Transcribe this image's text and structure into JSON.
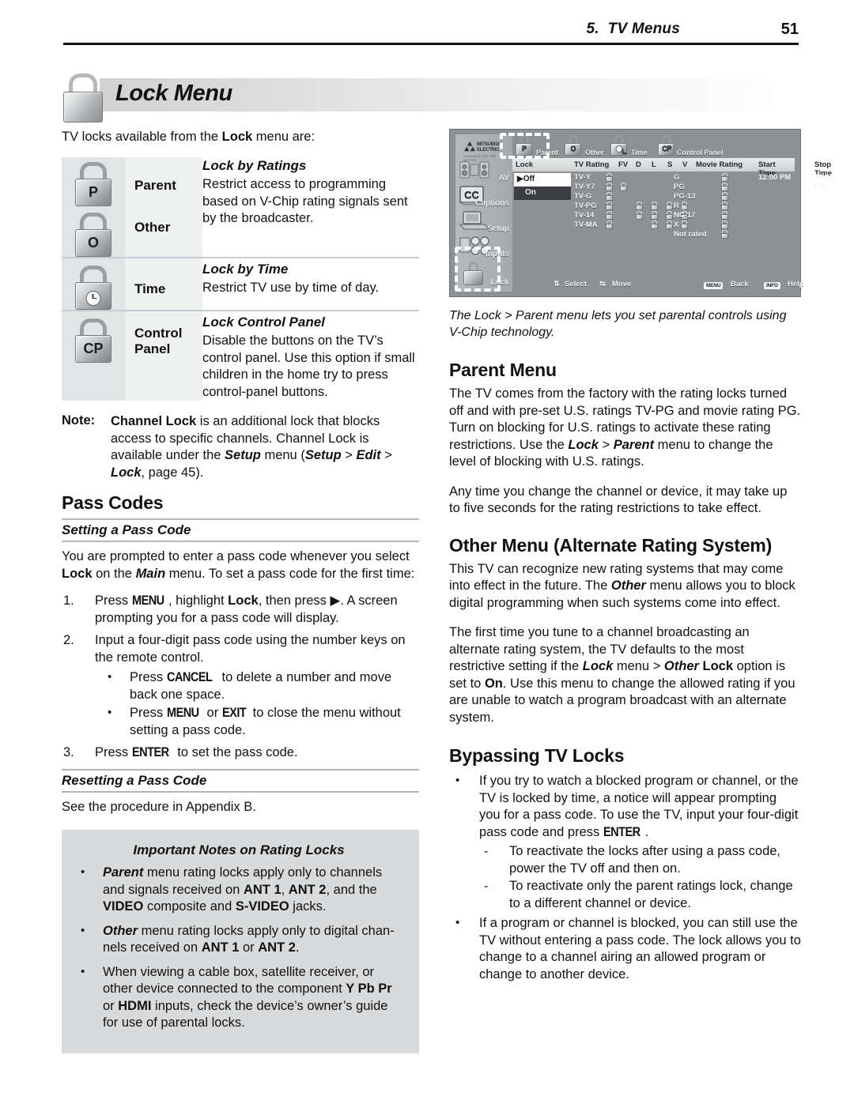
{
  "header": {
    "chapter": "5.",
    "title": "TV Menus",
    "page_number": "51"
  },
  "banner": {
    "title": "Lock Menu",
    "icon": "padlock-icon"
  },
  "intro": {
    "before": "TV locks available from the ",
    "bold": "Lock",
    "after": " menu are:"
  },
  "locks_table": {
    "rows": [
      {
        "icons": [
          {
            "label": "P",
            "name": "parent-lock-icon"
          },
          {
            "label": "O",
            "name": "other-lock-icon"
          }
        ],
        "names": [
          "Parent",
          "Other"
        ],
        "heading": "Lock by Ratings",
        "body": "Restrict access to programming based on V-Chip rating signals sent by the broadcaster."
      },
      {
        "icons": [
          {
            "label": "clock",
            "name": "time-lock-icon"
          }
        ],
        "names": [
          "Time"
        ],
        "heading": "Lock by Time",
        "body": "Restrict TV use by time of day."
      },
      {
        "icons": [
          {
            "label": "CP",
            "name": "control-panel-lock-icon"
          }
        ],
        "names": [
          "Control",
          "Panel"
        ],
        "heading": "Lock Control Panel",
        "body": "Disable the buttons on the TV’s control panel.  Use this option if small children in the home try to press control-panel buttons."
      }
    ]
  },
  "note": {
    "label": "Note:",
    "text_parts": [
      {
        "t": "Channel Lock",
        "s": "b"
      },
      {
        "t": " is an additional lock that blocks access to specific channels.  Channel Lock is available under the ",
        "s": "n"
      },
      {
        "t": "Setup",
        "s": "bi"
      },
      {
        "t": " menu (",
        "s": "n"
      },
      {
        "t": "Setup",
        "s": "bi"
      },
      {
        "t": " > ",
        "s": "n"
      },
      {
        "t": "Edit",
        "s": "bi"
      },
      {
        "t": " > ",
        "s": "n"
      },
      {
        "t": "Lock",
        "s": "bi"
      },
      {
        "t": ", page 45).",
        "s": "n"
      }
    ]
  },
  "pass_codes": {
    "heading": "Pass Codes",
    "setting_heading": "Setting a Pass Code",
    "setting_intro_parts": [
      {
        "t": "You are prompted to enter a pass code whenever you select ",
        "s": "n"
      },
      {
        "t": "Lock",
        "s": "b"
      },
      {
        "t": " on the ",
        "s": "n"
      },
      {
        "t": "Main",
        "s": "bi"
      },
      {
        "t": " menu.  To set a pass code for the first time:",
        "s": "n"
      }
    ],
    "steps": [
      {
        "num": "1.",
        "parts": [
          {
            "t": "Press ",
            "s": "n"
          },
          {
            "t": "MENU",
            "s": "k"
          },
          {
            "t": ", highlight ",
            "s": "n"
          },
          {
            "t": "Lock",
            "s": "b"
          },
          {
            "t": ", then press ",
            "s": "n"
          },
          {
            "t": "▶",
            "s": "n"
          },
          {
            "t": ".  A screen prompting you for a pass code will display.",
            "s": "n"
          }
        ],
        "sub": []
      },
      {
        "num": "2.",
        "parts": [
          {
            "t": "Input a four-digit pass code using the number keys on the remote control.",
            "s": "n"
          }
        ],
        "sub": [
          {
            "bullet": "•",
            "parts": [
              {
                "t": "Press ",
                "s": "n"
              },
              {
                "t": "CANCEL",
                "s": "k"
              },
              {
                "t": " to delete a number and move back one space.",
                "s": "n"
              }
            ]
          },
          {
            "bullet": "•",
            "parts": [
              {
                "t": "Press ",
                "s": "n"
              },
              {
                "t": "MENU",
                "s": "k"
              },
              {
                "t": " or ",
                "s": "n"
              },
              {
                "t": "EXIT",
                "s": "k"
              },
              {
                "t": " to close the menu without setting a pass code.",
                "s": "n"
              }
            ]
          }
        ]
      },
      {
        "num": "3.",
        "parts": [
          {
            "t": "Press ",
            "s": "n"
          },
          {
            "t": "ENTER",
            "s": "k"
          },
          {
            "t": " to set the pass code.",
            "s": "n"
          }
        ],
        "sub": []
      }
    ],
    "resetting_heading": "Resetting a Pass Code",
    "resetting_body": "See the procedure in Appendix B."
  },
  "important_box": {
    "heading": "Important Notes on Rating Locks",
    "bullets": [
      [
        {
          "t": "Parent",
          "s": "bi"
        },
        {
          "t": " menu rating locks apply only to channels and signals received on ",
          "s": "n"
        },
        {
          "t": "ANT 1",
          "s": "b"
        },
        {
          "t": ", ",
          "s": "n"
        },
        {
          "t": "ANT 2",
          "s": "b"
        },
        {
          "t": ", and the ",
          "s": "n"
        },
        {
          "t": "VIDEO",
          "s": "b"
        },
        {
          "t": " composite and ",
          "s": "n"
        },
        {
          "t": "S-VIDEO",
          "s": "b"
        },
        {
          "t": " jacks.",
          "s": "n"
        }
      ],
      [
        {
          "t": "Other",
          "s": "bi"
        },
        {
          "t": " menu rating locks apply only to digital chan-nels received on ",
          "s": "n"
        },
        {
          "t": "ANT 1",
          "s": "b"
        },
        {
          "t": " or ",
          "s": "n"
        },
        {
          "t": "ANT 2",
          "s": "b"
        },
        {
          "t": ".",
          "s": "n"
        }
      ],
      [
        {
          "t": "When viewing a cable box, satellite receiver, or other device connected to the component ",
          "s": "n"
        },
        {
          "t": "Y Pb Pr",
          "s": "b"
        },
        {
          "t": " or ",
          "s": "n"
        },
        {
          "t": "HDMI",
          "s": "b"
        },
        {
          "t": " inputs, check the device’s owner’s guide for use of parental locks.",
          "s": "n"
        }
      ]
    ]
  },
  "screenshot": {
    "brand": "MITSUBISHI ELECTRIC",
    "brand_sub": "CHANGES FOR THE BETTER",
    "sidebar": [
      {
        "label": "AV",
        "icon": "speakers-icon"
      },
      {
        "label": "Captions",
        "icon": "cc-icon"
      },
      {
        "label": "Setup",
        "icon": "setup-icon"
      },
      {
        "label": "Inputs",
        "icon": "inputs-icon"
      },
      {
        "label": "Lock",
        "icon": "lock-icon"
      }
    ],
    "tabs": [
      {
        "label": "Parent",
        "badge": "P",
        "selected": true
      },
      {
        "label": "Other",
        "badge": "O",
        "selected": false
      },
      {
        "label": "Time",
        "badge": "clock",
        "selected": false
      },
      {
        "label": "Control Panel",
        "badge": "CP",
        "selected": false
      }
    ],
    "columns": [
      "Lock",
      "TV Rating",
      "FV",
      "D",
      "L",
      "S",
      "V",
      "Movie Rating",
      "Start Time",
      "Stop Time"
    ],
    "lock_select": {
      "selected": "Off",
      "options": [
        "Off",
        "On"
      ],
      "marker": "▶"
    },
    "tv_ratings": [
      "TV-Y",
      "TV-Y7",
      "TV-G",
      "TV-PG",
      "TV-14",
      "TV-MA"
    ],
    "movie_ratings": [
      "G",
      "PG",
      "PG-13",
      "R",
      "NC-17",
      "X",
      "Not rated"
    ],
    "start_time": "12:00 PM",
    "stop_time": "12:00 PM",
    "footer": [
      {
        "icon": "updown-arrows-icon",
        "label": "Select"
      },
      {
        "icon": "leftright-arrows-icon",
        "label": "Move"
      },
      {
        "key": "MENU",
        "label": "Back"
      },
      {
        "key": "INFO",
        "label": "Help"
      }
    ]
  },
  "caption": "The Lock > Parent menu lets you set parental controls using V-Chip technology.",
  "parent_menu": {
    "heading": "Parent Menu",
    "p1": [
      {
        "t": "The TV comes from the factory with the rating locks turned off and with pre-set U.S. ratings TV-PG and movie rating PG.  Turn on blocking for U.S. ratings to activate these rating restrictions.  Use the ",
        "s": "n"
      },
      {
        "t": "Lock",
        "s": "bi"
      },
      {
        "t": " > ",
        "s": "n"
      },
      {
        "t": "Parent",
        "s": "bi"
      },
      {
        "t": " menu to change the level of blocking with U.S. ratings.",
        "s": "n"
      }
    ],
    "p2": [
      {
        "t": "Any time you change the channel or device, it may take up to five seconds for the rating restrictions to take effect.",
        "s": "n"
      }
    ]
  },
  "other_menu": {
    "heading": "Other Menu (Alternate Rating System)",
    "p1": [
      {
        "t": "This TV can recognize new rating systems that may come into effect in the future.  The ",
        "s": "n"
      },
      {
        "t": "Other",
        "s": "bi"
      },
      {
        "t": " menu allows you to block digital programming when such systems come into effect.",
        "s": "n"
      }
    ],
    "p2": [
      {
        "t": "The first time you tune to a channel broadcasting an alternate rating system, the TV defaults to the most restrictive setting if the ",
        "s": "n"
      },
      {
        "t": "Lock",
        "s": "bi"
      },
      {
        "t": " menu > ",
        "s": "n"
      },
      {
        "t": "Other",
        "s": "bi"
      },
      {
        "t": " Lock",
        "s": "b"
      },
      {
        "t": " option is set to ",
        "s": "n"
      },
      {
        "t": "On",
        "s": "b"
      },
      {
        "t": ".  Use this menu to change the allowed rating if you are unable to watch a program broadcast with an alternate system.",
        "s": "n"
      }
    ]
  },
  "bypassing": {
    "heading": "Bypassing TV Locks",
    "bullet1": [
      {
        "t": "If you try to watch a blocked program or channel, or the TV is locked by time, a notice will appear prompting you for a pass code.  To use the TV, input your four-digit pass code and press ",
        "s": "n"
      },
      {
        "t": "ENTER",
        "s": "k"
      },
      {
        "t": ".",
        "s": "n"
      }
    ],
    "dashes": [
      [
        {
          "t": "To reactivate the locks after using a pass code, power the TV off and then on.",
          "s": "n"
        }
      ],
      [
        {
          "t": "To reactivate only the parent ratings lock, change to a different channel or device.",
          "s": "n"
        }
      ]
    ],
    "bullet2": [
      {
        "t": "If a program or channel is blocked, you can still use the TV without entering a pass code.  The lock allows you to change to a channel airing an allowed program or change to another device.",
        "s": "n"
      }
    ],
    "dash_char": "-",
    "bullet_char": "•"
  }
}
